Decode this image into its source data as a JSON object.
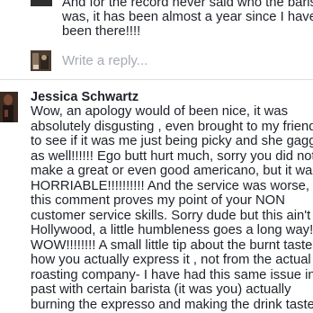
{
  "previous_reply": {
    "text": "And for the record never said who the barist\nwas, it has been almost a year since I have\nbeen there!!!!"
  },
  "reply_box": {
    "placeholder": "Write a reply..."
  },
  "comment": {
    "author": "Jessica Schwartz",
    "body": "Wow, an apology would of been nice, it was\nabsolutely disgusting , even brought to my friends\nto see if it was me just being picky and she gagge\nas well!!!!!! Ego butt hurt much, sorry you did not\nmake a great or even good americano, but it was\nHORRIABLE!!!!!!!!!! And the service was worse, ar\nthis comment proves my point of your NON\ncustomer service skills. Sorry dude but this ain't\nHollywood, a little humbleness goes a long way!\nWOW!!!!!!!! A small little tip about the burnt taste i\nhow you actually express it , not from the actual\nroasting company- I have had this same issue in tl\npast with certain barista (it was you) actually\nburning the expresso and making the drink taste\nburnt!!!!!!!"
  }
}
